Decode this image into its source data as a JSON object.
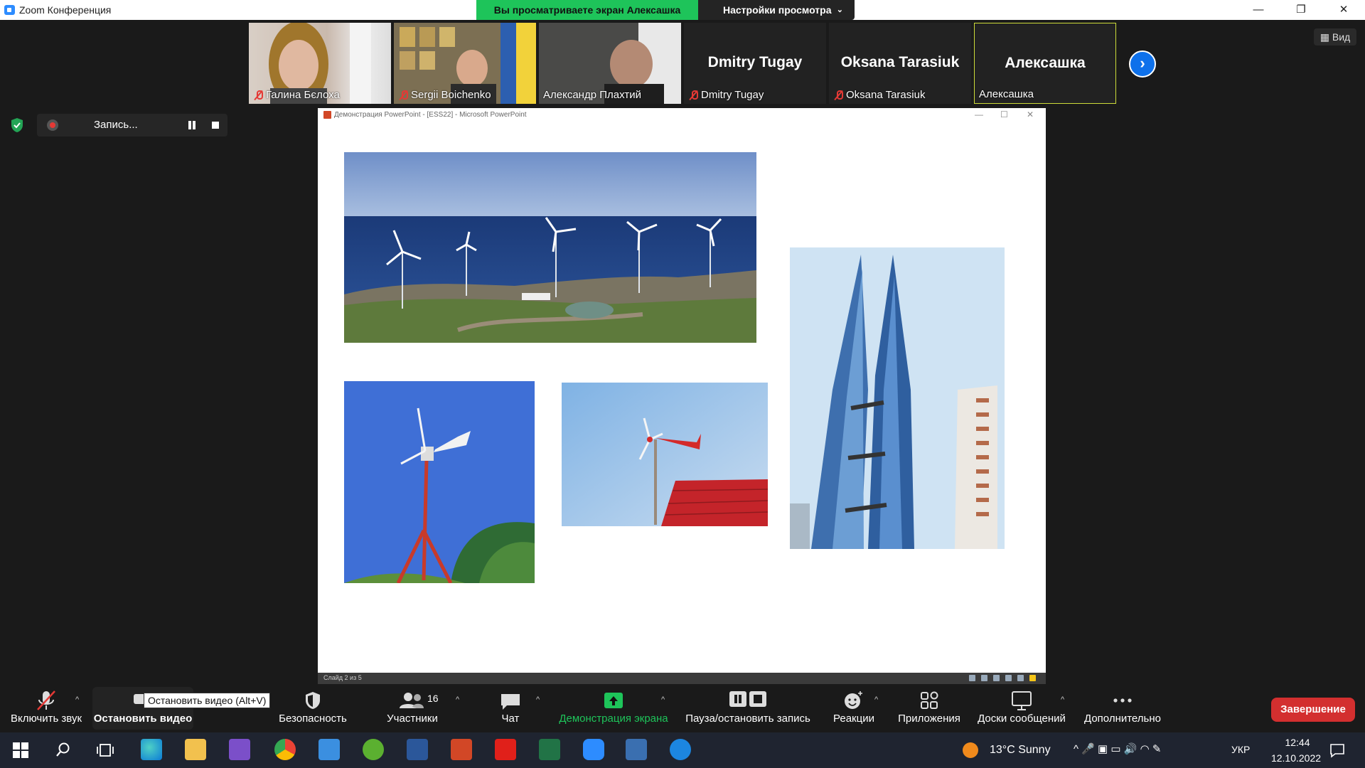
{
  "window": {
    "title": "Zoom Конференция"
  },
  "banner": {
    "viewing": "Вы просматриваете экран Алексашка",
    "view_settings": "Настройки просмотра"
  },
  "window_controls": {
    "minimize": "—",
    "restore": "❐",
    "close": "✕"
  },
  "participants": [
    {
      "name": "Галина Бєлоха",
      "muted": true,
      "video": true
    },
    {
      "name": "Sergii Boichenko",
      "muted": true,
      "video": true
    },
    {
      "name": "Александр Плахтий",
      "muted": false,
      "video": true
    },
    {
      "name": "Dmitry Tugay",
      "display": "Dmitry Tugay",
      "muted": true,
      "video": false
    },
    {
      "name": "Oksana Tarasiuk",
      "display": "Oksana Tarasiuk",
      "muted": true,
      "video": false
    },
    {
      "name": "Алексашка",
      "display": "Алексашка",
      "muted": false,
      "video": false
    }
  ],
  "view_button": "Вид",
  "recording": {
    "label": "Запись..."
  },
  "presentation": {
    "window_title": "Демонстрация PowerPoint - [ESS22] - Microsoft PowerPoint",
    "status": "Слайд 2 из 5",
    "photos": [
      "wind-farm-coast",
      "tall-wind-turbine",
      "roof-wind-turbine",
      "bahrain-world-trade-center"
    ]
  },
  "toolbar": {
    "unmute": "Включить звук",
    "stop_video": "Остановить видео",
    "tooltip": "Остановить видео (Alt+V)",
    "security": "Безопасность",
    "participants": "Участники",
    "participants_count": "16",
    "chat": "Чат",
    "share": "Демонстрация экрана",
    "record": "Пауза/остановить запись",
    "reactions": "Реакции",
    "apps": "Приложения",
    "whiteboards": "Доски сообщений",
    "more": "Дополнительно",
    "end": "Завершение"
  },
  "taskbar": {
    "weather": "13°C  Sunny",
    "lang": "УКР",
    "time": "12:44",
    "date": "12.10.2022"
  },
  "colors": {
    "share_green": "#1ec45a",
    "end_red": "#d32f2f",
    "accent_blue": "#0e71eb"
  }
}
